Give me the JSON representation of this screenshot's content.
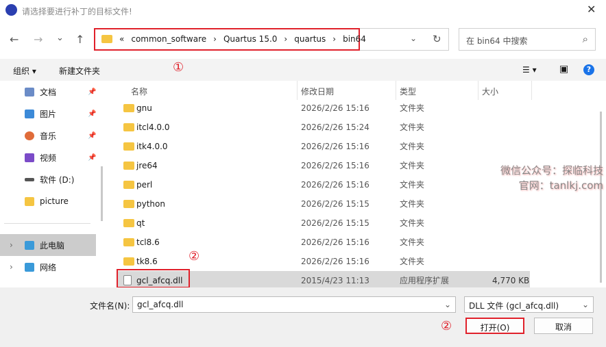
{
  "window": {
    "title": "请选择要进行补丁的目标文件!",
    "close": "✕"
  },
  "nav": {
    "back": "←",
    "forward": "→",
    "recent": "⌄",
    "up": "↑",
    "refresh": "↻",
    "dropdown": "⌄",
    "crumbs": [
      "«",
      "common_software",
      "›",
      "Quartus 15.0",
      "›",
      "quartus",
      "›",
      "bin64"
    ],
    "search_placeholder": "在 bin64 中搜索",
    "search_icon": "⌕"
  },
  "toolbar": {
    "organize": "组织 ▾",
    "new_folder": "新建文件夹",
    "view": "☰ ▾",
    "pane": "▣",
    "help": "?"
  },
  "annotations": {
    "one": "①",
    "two": "②",
    "three": "②"
  },
  "sidebar": {
    "items": [
      {
        "label": "文档",
        "color": "#6b8cc7"
      },
      {
        "label": "图片",
        "color": "#3c8ad8"
      },
      {
        "label": "音乐",
        "color": "#e06c3a"
      },
      {
        "label": "视频",
        "color": "#7b4bc8"
      },
      {
        "label": "软件 (D:)",
        "color": "#555"
      },
      {
        "label": "picture",
        "color": "#f5c542"
      },
      {
        "label": "此电脑",
        "color": "#3a9ad9"
      },
      {
        "label": "网络",
        "color": "#3a9ad9"
      }
    ],
    "pin": "📌",
    "expand": "›"
  },
  "columns": {
    "name": "名称",
    "date": "修改日期",
    "type": "类型",
    "size": "大小"
  },
  "files": [
    {
      "name": "gnu",
      "date": "2026/2/26 15:16",
      "type": "文件夹",
      "size": ""
    },
    {
      "name": "itcl4.0.0",
      "date": "2026/2/26 15:24",
      "type": "文件夹",
      "size": ""
    },
    {
      "name": "itk4.0.0",
      "date": "2026/2/26 15:16",
      "type": "文件夹",
      "size": ""
    },
    {
      "name": "jre64",
      "date": "2026/2/26 15:16",
      "type": "文件夹",
      "size": ""
    },
    {
      "name": "perl",
      "date": "2026/2/26 15:16",
      "type": "文件夹",
      "size": ""
    },
    {
      "name": "python",
      "date": "2026/2/26 15:15",
      "type": "文件夹",
      "size": ""
    },
    {
      "name": "qt",
      "date": "2026/2/26 15:15",
      "type": "文件夹",
      "size": ""
    },
    {
      "name": "tcl8.6",
      "date": "2026/2/26 15:16",
      "type": "文件夹",
      "size": ""
    },
    {
      "name": "tk8.6",
      "date": "2026/2/26 15:16",
      "type": "文件夹",
      "size": ""
    },
    {
      "name": "gcl_afcq.dll",
      "date": "2015/4/23 11:13",
      "type": "应用程序扩展",
      "size": "4,770 KB"
    }
  ],
  "watermark": {
    "line1": "微信公众号：探临科技",
    "line2": "官网：tanlkj.com"
  },
  "bottom": {
    "filename_label": "文件名(N):",
    "filename_value": "gcl_afcq.dll",
    "filter": "DLL 文件 (gcl_afcq.dll)",
    "open": "打开(O)",
    "cancel": "取消"
  }
}
